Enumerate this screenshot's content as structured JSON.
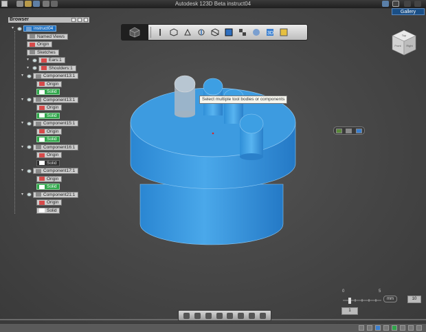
{
  "window": {
    "title": "Autodesk 123D Beta   instruct04"
  },
  "header": {
    "gallery_label": "Gallery"
  },
  "browser": {
    "title": "Browser",
    "items": [
      {
        "label": "instruct04",
        "kind": "root",
        "selected": true
      },
      {
        "label": "Named Views",
        "kind": "folder"
      },
      {
        "label": "Origin",
        "kind": "origin"
      },
      {
        "label": "Sketches",
        "kind": "folder"
      },
      {
        "label": "Ears:1",
        "kind": "component"
      },
      {
        "label": "Shoulders:1",
        "kind": "component"
      },
      {
        "label": "Component13:1",
        "kind": "component"
      },
      {
        "label": "Origin",
        "kind": "origin"
      },
      {
        "label": "Solid",
        "kind": "solid",
        "highlight": "green"
      },
      {
        "label": "Component13:1",
        "kind": "component"
      },
      {
        "label": "Origin",
        "kind": "origin"
      },
      {
        "label": "Solid",
        "kind": "solid",
        "highlight": "green"
      },
      {
        "label": "Component15:1",
        "kind": "component"
      },
      {
        "label": "Origin",
        "kind": "origin"
      },
      {
        "label": "Solid",
        "kind": "solid",
        "highlight": "green"
      },
      {
        "label": "Component16:1",
        "kind": "component"
      },
      {
        "label": "Origin",
        "kind": "origin"
      },
      {
        "label": "Solid",
        "kind": "solid",
        "highlight": "dark"
      },
      {
        "label": "Component17:1",
        "kind": "component"
      },
      {
        "label": "Origin",
        "kind": "origin"
      },
      {
        "label": "Solid",
        "kind": "solid",
        "highlight": "green"
      },
      {
        "label": "Component21:1",
        "kind": "component"
      },
      {
        "label": "Origin",
        "kind": "origin"
      },
      {
        "label": "Solid",
        "kind": "solid",
        "highlight": "none"
      }
    ]
  },
  "tooltip": {
    "text": "Select multiple tool bodies or components"
  },
  "ruler": {
    "tick_left": "0",
    "tick_right": "5",
    "unit": "mm",
    "value": "10",
    "scale_value": "1"
  },
  "viewcube": {
    "top": "Top",
    "front": "Front",
    "right": "Right"
  },
  "colors": {
    "model_blue": "#3d9be0",
    "selection_blue": "#1d6fc0",
    "solid_green": "#2fa64a"
  }
}
